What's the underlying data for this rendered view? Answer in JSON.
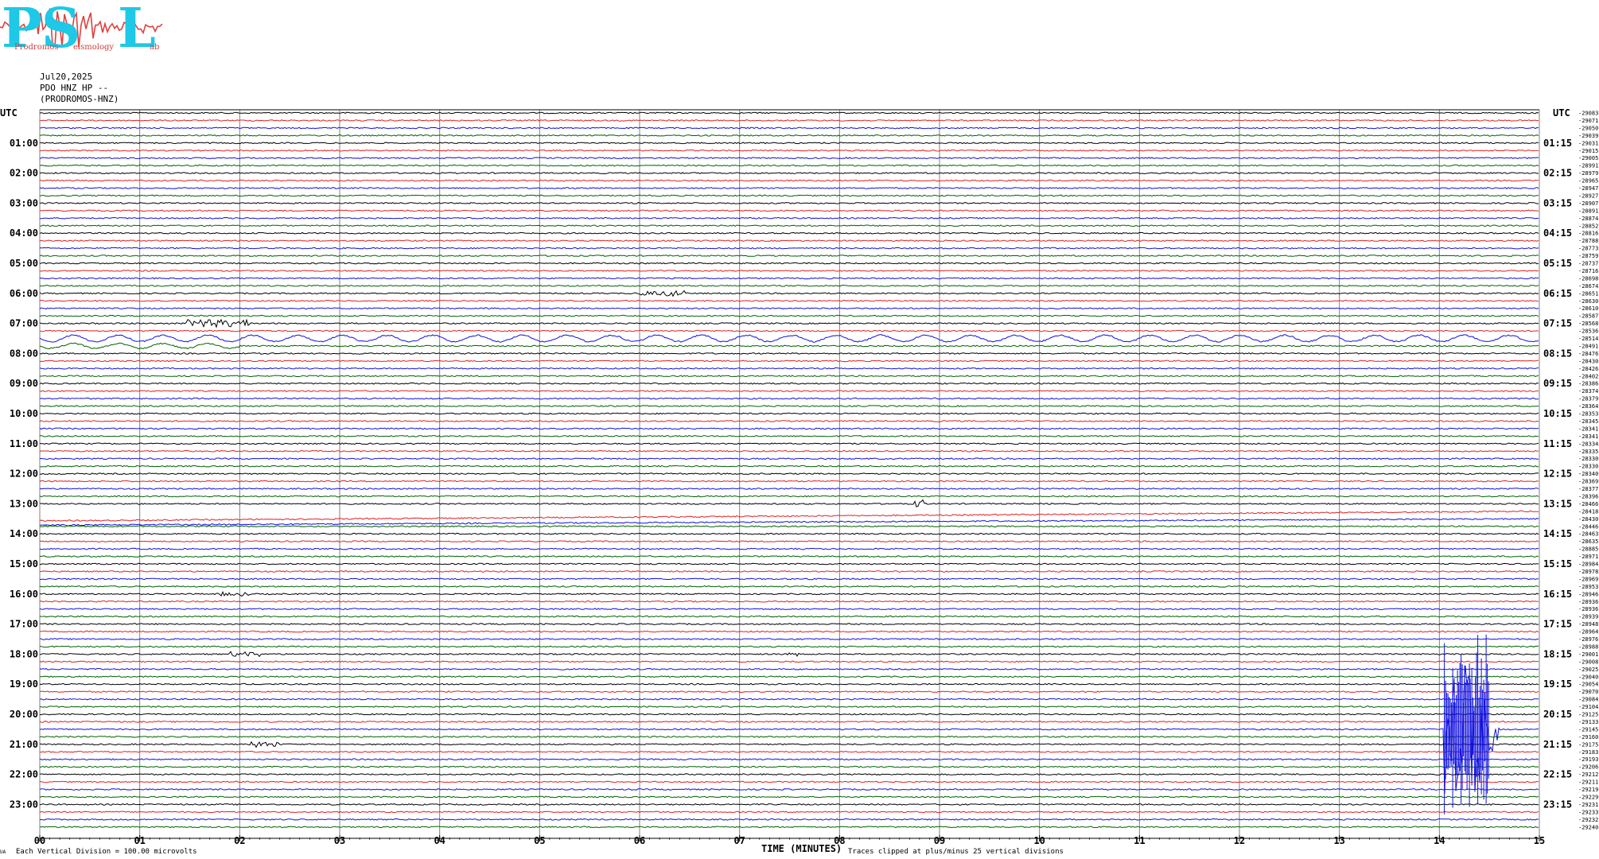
{
  "logo": {
    "letters": [
      "P",
      "S",
      "L"
    ],
    "words": [
      "Prodromos",
      "eismology",
      "ab"
    ],
    "colors": {
      "letters": "#1ec8e6",
      "wave": "#e04040"
    }
  },
  "header": {
    "date": "Jul20,2025",
    "station": "PDO HNZ HP --",
    "location": "(PRODROMOS-HNZ)"
  },
  "utc_label_left": "UTC",
  "utc_label_right": "UTC",
  "chart_data": {
    "type": "line",
    "description_free": true,
    "xlabel": "TIME (MINUTES)",
    "x_ticks": [
      "00",
      "01",
      "02",
      "03",
      "04",
      "05",
      "06",
      "07",
      "08",
      "09",
      "10",
      "11",
      "12",
      "13",
      "14",
      "15"
    ],
    "xlim": [
      0,
      15
    ],
    "hour_labels_left": [
      "01:00",
      "02:00",
      "03:00",
      "04:00",
      "05:00",
      "06:00",
      "07:00",
      "08:00",
      "09:00",
      "10:00",
      "11:00",
      "12:00",
      "13:00",
      "14:00",
      "15:00",
      "16:00",
      "17:00",
      "18:00",
      "19:00",
      "20:00",
      "21:00",
      "22:00",
      "23:00"
    ],
    "hour_labels_right": [
      "01:15",
      "02:15",
      "03:15",
      "04:15",
      "05:15",
      "06:15",
      "07:15",
      "08:15",
      "09:15",
      "10:15",
      "11:15",
      "12:15",
      "13:15",
      "14:15",
      "15:15",
      "16:15",
      "17:15",
      "18:15",
      "19:15",
      "20:15",
      "21:15",
      "22:15",
      "23:15"
    ],
    "trace_colors": [
      "#000000",
      "#e02020",
      "#1010e0",
      "#006000"
    ],
    "trace_count": 96,
    "right_offsets": [
      "-29083",
      "-29071",
      "-29050",
      "-29039",
      "-29031",
      "-29015",
      "-29005",
      "-28991",
      "-28979",
      "-28965",
      "-28947",
      "-28927",
      "-28907",
      "-28891",
      "-28874",
      "-28852",
      "-28816",
      "-28788",
      "-28773",
      "-28759",
      "-28737",
      "-28716",
      "-28698",
      "-28674",
      "-28651",
      "-28630",
      "-28610",
      "-28587",
      "-28568",
      "-28536",
      "-28514",
      "-28491",
      "-28476",
      "-28430",
      "-28426",
      "-28402",
      "-28386",
      "-28374",
      "-28379",
      "-28364",
      "-28353",
      "-28345",
      "-28341",
      "-28341",
      "-28334",
      "-28335",
      "-28330",
      "-28330",
      "-28340",
      "-28369",
      "-28377",
      "-28396",
      "-28466",
      "-28418",
      "-28430",
      "-28446",
      "-28463",
      "-28635",
      "-28885",
      "-28971",
      "-28984",
      "-28978",
      "-28969",
      "-28953",
      "-28946",
      "-28936",
      "-28936",
      "-28939",
      "-28948",
      "-28964",
      "-28976",
      "-28988",
      "-29001",
      "-29008",
      "-29025",
      "-29040",
      "-29054",
      "-29070",
      "-29084",
      "-29104",
      "-29125",
      "-29133",
      "-29145",
      "-29160",
      "-29175",
      "-29183",
      "-29193",
      "-29206",
      "-29212",
      "-29211",
      "-29219",
      "-29229",
      "-29231",
      "-29233",
      "-29232",
      "-29240"
    ],
    "events": [
      {
        "trace": 24,
        "x_min": [
          6.0,
          6.45
        ],
        "amp": 3,
        "note": "small burst"
      },
      {
        "trace": 28,
        "x_min": [
          1.45,
          2.1
        ],
        "amp": 5
      },
      {
        "trace": 30,
        "x_min": [
          0.0,
          15.0
        ],
        "amp": 4,
        "type": "swell"
      },
      {
        "trace": 31,
        "x_min": [
          0.0,
          2.0
        ],
        "amp": 3,
        "type": "swell"
      },
      {
        "trace": 52,
        "x_min": [
          8.75,
          8.85
        ],
        "amp": 5
      },
      {
        "trace": 64,
        "x_min": [
          1.8,
          2.1
        ],
        "amp": 2
      },
      {
        "trace": 72,
        "x_min": [
          1.9,
          2.2
        ],
        "amp": 3
      },
      {
        "trace": 72,
        "x_min": [
          7.45,
          7.6
        ],
        "amp": 2
      },
      {
        "trace": 84,
        "x_min": [
          2.1,
          2.4
        ],
        "amp": 3
      },
      {
        "trace": 82,
        "x_min": [
          14.05,
          14.6
        ],
        "amp": 90,
        "type": "quake"
      }
    ]
  },
  "footer": {
    "vertical_division": "Each Vertical Division =  100.00 microvolts",
    "clip_note": "Traces clipped at plus/minus 25 vertical divisions",
    "corner_mark": "UA"
  }
}
